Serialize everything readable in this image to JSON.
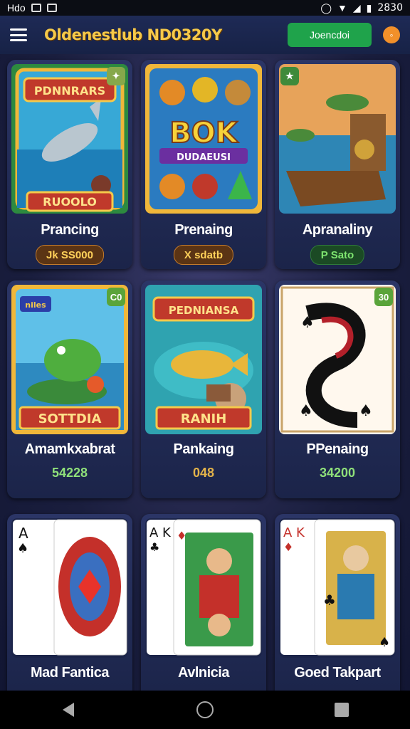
{
  "status_bar": {
    "left_text": "Hdo",
    "clock": "2830"
  },
  "header": {
    "title": "Oldenestlub ND0320Y",
    "login_label": "Joencdoi",
    "menu_icon": "hamburger-icon",
    "coin_icon": "coin-icon"
  },
  "cards": [
    {
      "name": "Prancing",
      "value": "Jk SS000",
      "banner": "PDNNRARS",
      "sign": "RUOOLO",
      "style": "brown"
    },
    {
      "name": "Prenaing",
      "value": "X sdatb",
      "banner": "BOK",
      "sign": "DUDAEUSI",
      "style": "brown"
    },
    {
      "name": "Apranaliny",
      "value": "P Sato",
      "banner": "",
      "sign": "",
      "style": "green"
    },
    {
      "name": "Amamkxabrat",
      "value": "54228",
      "banner": "niles",
      "sign": "SOTTDIA",
      "style": "plain"
    },
    {
      "name": "Pankaing",
      "value": "048",
      "banner": "PEDNIANSA",
      "sign": "RANIH",
      "style": "plain"
    },
    {
      "name": "PPenaing",
      "value": "34200",
      "banner": "",
      "sign": "",
      "style": "plain"
    },
    {
      "name": "Mad Fantica",
      "value": "",
      "banner": "A",
      "sign": "",
      "style": "none"
    },
    {
      "name": "Avlnicia",
      "value": "",
      "banner": "A K",
      "sign": "",
      "style": "none"
    },
    {
      "name": "Goed Takpart",
      "value": "",
      "banner": "A K",
      "sign": "",
      "style": "none"
    }
  ],
  "badges": [
    "C0",
    "30"
  ]
}
